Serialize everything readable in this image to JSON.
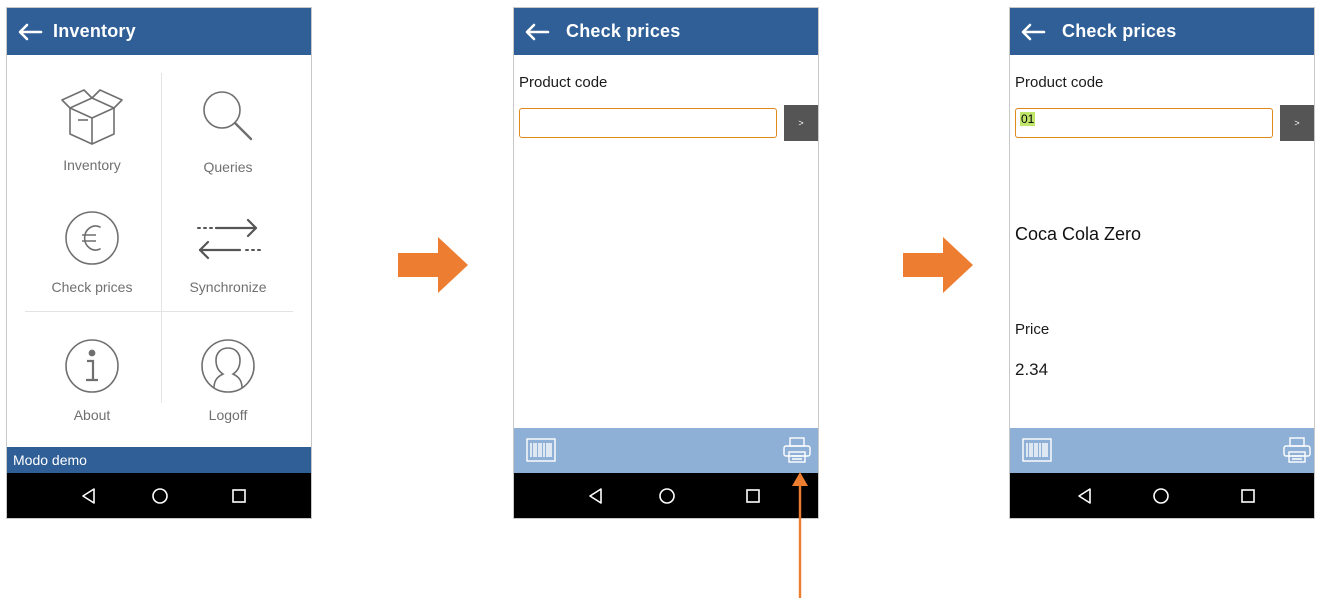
{
  "screen1": {
    "title": "Inventory",
    "tiles": [
      {
        "label": "Inventory",
        "icon": "box-icon"
      },
      {
        "label": "Queries",
        "icon": "search-icon"
      },
      {
        "label": "Check prices",
        "icon": "euro-icon"
      },
      {
        "label": "Synchronize",
        "icon": "sync-arrows-icon"
      },
      {
        "label": "About",
        "icon": "info-icon"
      },
      {
        "label": "Logoff",
        "icon": "user-icon"
      }
    ],
    "status": "Modo demo"
  },
  "screen2": {
    "title": "Check prices",
    "product_code_label": "Product code",
    "product_code_value": "",
    "go_label": ">"
  },
  "screen3": {
    "title": "Check prices",
    "product_code_label": "Product code",
    "product_code_value": "01",
    "go_label": ">",
    "product_name": "Coca Cola Zero",
    "price_label": "Price",
    "price_value": "2.34"
  },
  "colors": {
    "header": "#2f5f96",
    "toolbar": "#8fb0d6",
    "arrow": "#ed7d31",
    "input_border": "#e08a1e"
  }
}
